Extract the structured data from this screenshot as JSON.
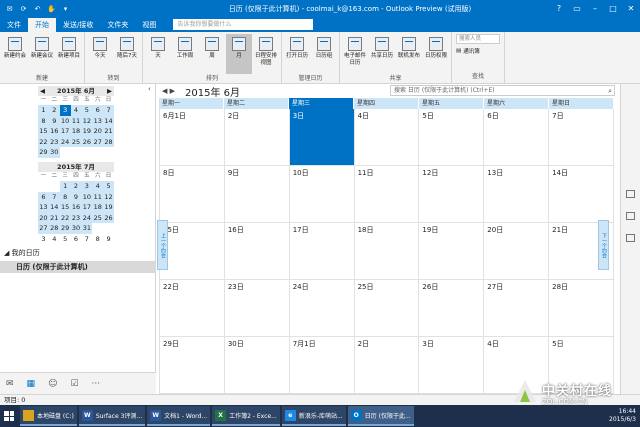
{
  "titlebar": {
    "title": "日历 (仅限于此计算机) - coolmai_k@163.com - Outlook Preview (试用版)"
  },
  "tabs": [
    {
      "label": "文件"
    },
    {
      "label": "开始"
    },
    {
      "label": "发送/接收"
    },
    {
      "label": "文件夹"
    },
    {
      "label": "视图"
    }
  ],
  "ribbon": {
    "search_placeholder": "告诉我你想要做什么",
    "groups": [
      {
        "label": "新建",
        "buttons": [
          "新建约会",
          "新建会议",
          "新建项目"
        ]
      },
      {
        "label": "转到",
        "buttons": [
          "今天",
          "随后7天"
        ]
      },
      {
        "label": "排列",
        "buttons": [
          "天",
          "工作周",
          "周",
          "月",
          "日程安排视图"
        ]
      },
      {
        "label": "管理日历",
        "buttons": [
          "打开日历",
          "日历组"
        ]
      },
      {
        "label": "共享",
        "buttons": [
          "电子邮件日历",
          "共享日历",
          "联机发布",
          "日历权限"
        ]
      }
    ],
    "find": {
      "label": "查找",
      "people_placeholder": "搜索人员",
      "address_book": "通讯簿"
    }
  },
  "mini_calendars": [
    {
      "title": "2015年 6月",
      "dows": [
        "一",
        "二",
        "三",
        "四",
        "五",
        "六",
        "日"
      ],
      "days": [
        [
          1,
          2,
          3,
          4,
          5,
          6,
          7
        ],
        [
          8,
          9,
          10,
          11,
          12,
          13,
          14
        ],
        [
          15,
          16,
          17,
          18,
          19,
          20,
          21
        ],
        [
          22,
          23,
          24,
          25,
          26,
          27,
          28
        ],
        [
          29,
          30,
          "",
          "",
          "",
          "",
          ""
        ]
      ],
      "today": 3
    },
    {
      "title": "2015年 7月",
      "dows": [
        "一",
        "二",
        "三",
        "四",
        "五",
        "六",
        "日"
      ],
      "days": [
        [
          "",
          "",
          1,
          2,
          3,
          4,
          5
        ],
        [
          6,
          7,
          8,
          9,
          10,
          11,
          12
        ],
        [
          13,
          14,
          15,
          16,
          17,
          18,
          19
        ],
        [
          20,
          21,
          22,
          23,
          24,
          25,
          26
        ],
        [
          27,
          28,
          29,
          30,
          31,
          "",
          ""
        ],
        [
          3,
          4,
          5,
          6,
          7,
          8,
          9
        ]
      ]
    }
  ],
  "left_pane": {
    "group_header": "我的日历",
    "calendar_item": "日历 (仅限于此计算机)"
  },
  "calendar": {
    "month_title": "2015年 6月",
    "search_placeholder": "搜索 日历 (仅限于此计算机) (Ctrl+E)",
    "dows": [
      "星期一",
      "星期二",
      "星期三",
      "星期四",
      "星期五",
      "星期六",
      "星期日"
    ],
    "selected_dow": 2,
    "weeks": [
      [
        "6月1日",
        "2日",
        "3日",
        "4日",
        "5日",
        "6日",
        "7日"
      ],
      [
        "8日",
        "9日",
        "10日",
        "11日",
        "12日",
        "13日",
        "14日"
      ],
      [
        "15日",
        "16日",
        "17日",
        "18日",
        "19日",
        "20日",
        "21日"
      ],
      [
        "22日",
        "23日",
        "24日",
        "25日",
        "26日",
        "27日",
        "28日"
      ],
      [
        "29日",
        "30日",
        "7月1日",
        "2日",
        "3日",
        "4日",
        "5日"
      ]
    ],
    "today_cell": [
      0,
      2
    ],
    "prev_appointment": "上一个约会",
    "next_appointment": "下一个约会"
  },
  "statusbar": {
    "text": "项目: 0"
  },
  "taskbar": {
    "items": [
      {
        "badge": "",
        "label": "本地磁盘 (C:)"
      },
      {
        "badge": "W",
        "label": "Surface 3评测..."
      },
      {
        "badge": "W",
        "label": "文档1 - Word..."
      },
      {
        "badge": "X",
        "label": "工作簿2 - Exce..."
      },
      {
        "badge": "e",
        "label": "新浪乐-库萌站..."
      },
      {
        "badge": "O",
        "label": "日历 (仅限于此..."
      }
    ],
    "time": "16:44",
    "date": "2015/6/3"
  },
  "watermark": {
    "title": "中关村在线",
    "subtitle": "ZOL.COM.CN"
  },
  "colors": {
    "accent": "#0072c6",
    "highlight": "#cde6f7"
  }
}
